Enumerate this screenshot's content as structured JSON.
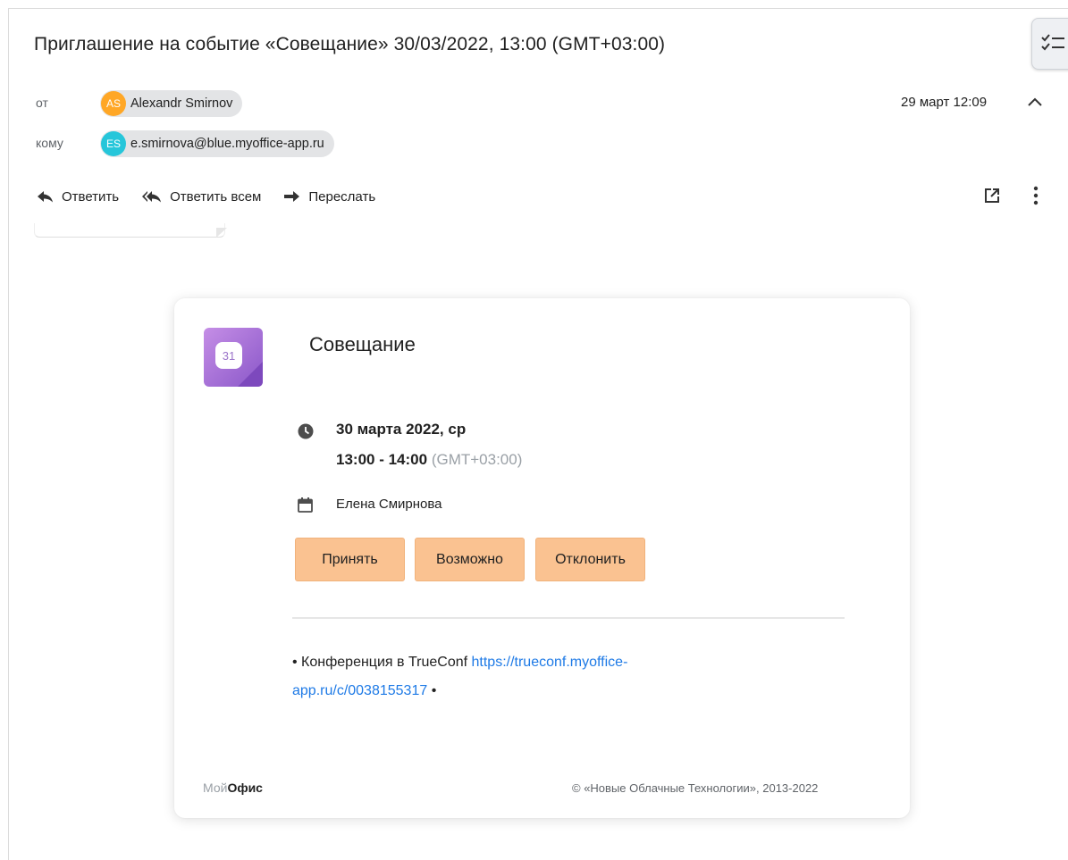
{
  "message": {
    "subject": "Приглашение на событие «Совещание» 30/03/2022, 13:00 (GMT+03:00)",
    "from_label": "от",
    "to_label": "кому",
    "from": {
      "initials": "AS",
      "name": "Alexandr Smirnov",
      "avatar_color": "#ffa726"
    },
    "to": {
      "initials": "ES",
      "email": "e.smirnova@blue.myoffice-app.ru",
      "avatar_color": "#26c6da"
    },
    "date": "29 март 12:09"
  },
  "actions": {
    "reply": "Ответить",
    "reply_all": "Ответить всем",
    "forward": "Переслать"
  },
  "event": {
    "calendar_icon_day": "31",
    "title": "Совещание",
    "date_line": "30 марта 2022, ср",
    "time_range": "13:00 - 14:00",
    "timezone": "(GMT+03:00)",
    "organizer": "Елена Смирнова",
    "buttons": {
      "accept": "Принять",
      "maybe": "Возможно",
      "decline": "Отклонить"
    },
    "button_color": "#fac291",
    "conference_prefix": "• Конференция в TrueConf ",
    "conference_link": "https://trueconf.myoffice-app.ru/c/0038155317",
    "conference_suffix": " •",
    "link_color": "#1e7ae6",
    "brand_light": "Мой",
    "brand_bold": "Офис",
    "copyright": "© «Новые Облачные Технологии», 2013-2022"
  }
}
